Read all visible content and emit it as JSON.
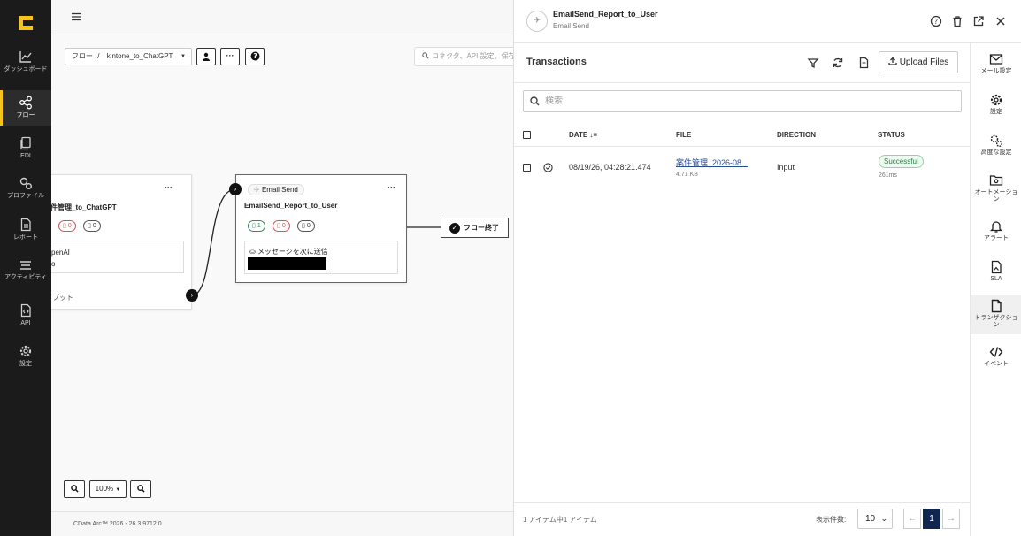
{
  "left_nav": {
    "items": [
      {
        "label": "ダッシュボード",
        "icon": "chart-line-icon"
      },
      {
        "label": "フロー",
        "icon": "share-nodes-icon",
        "active": true
      },
      {
        "label": "EDI",
        "icon": "documents-icon"
      },
      {
        "label": "プロファイル",
        "icon": "gears-icon"
      },
      {
        "label": "レポート",
        "icon": "report-icon"
      },
      {
        "label": "アクティビティ",
        "icon": "layers-icon"
      },
      {
        "label": "API",
        "icon": "api-icon"
      },
      {
        "label": "設定",
        "icon": "gear-icon"
      }
    ]
  },
  "canvas": {
    "breadcrumb": {
      "root": "フロー",
      "sep": "/",
      "flow": "kintone_to_ChatGPT"
    },
    "search_placeholder": "コネクタ、API 設定、保存",
    "node_left": {
      "title": "件管理_to_ChatGPT",
      "badge_red": "0",
      "badge_gray": "0",
      "box_line1": "penAI",
      "box_line2": "o",
      "output_label": "プット"
    },
    "node_email": {
      "tag": "Email Send",
      "title": "EmailSend_Report_to_User",
      "badge_green": "1",
      "badge_red": "0",
      "badge_gray": "0",
      "box_label": "メッセージを次に送信"
    },
    "end_node": "フロー終了",
    "zoom": "100%",
    "footer": "CData Arc™ 2026 - 26.3.9712.0"
  },
  "panel": {
    "title": "EmailSend_Report_to_User",
    "subtitle": "Email Send",
    "tx_title": "Transactions",
    "upload_label": "Upload Files",
    "search_placeholder": "検索",
    "columns": {
      "date": "DATE",
      "file": "FILE",
      "direction": "DIRECTION",
      "status": "STATUS"
    },
    "rows": [
      {
        "date": "08/19/26, 04:28:21.474",
        "file": "案件管理_2026-08...",
        "size": "4.71 KB",
        "direction": "Input",
        "status": "Successful",
        "duration": "261ms"
      }
    ],
    "pager": {
      "info": "1 アイテム中1 アイテム",
      "per_page_label": "表示件数:",
      "per_page": "10",
      "current": "1"
    },
    "right_nav": [
      {
        "label": "メール設定",
        "icon": "envelope-icon"
      },
      {
        "label": "設定",
        "icon": "gear-icon"
      },
      {
        "label": "高度な設定",
        "icon": "gears-icon"
      },
      {
        "label": "オートメーション",
        "icon": "folder-gear-icon"
      },
      {
        "label": "アラート",
        "icon": "bell-icon"
      },
      {
        "label": "SLA",
        "icon": "sla-file-icon"
      },
      {
        "label": "トランザクション",
        "icon": "file-icon",
        "active": true
      },
      {
        "label": "イベント",
        "icon": "code-icon"
      }
    ]
  },
  "colors": {
    "accent": "#f6c31a",
    "nav_bg": "#1b1b1b",
    "success": "#2e7d46",
    "pager_active": "#10264f"
  }
}
